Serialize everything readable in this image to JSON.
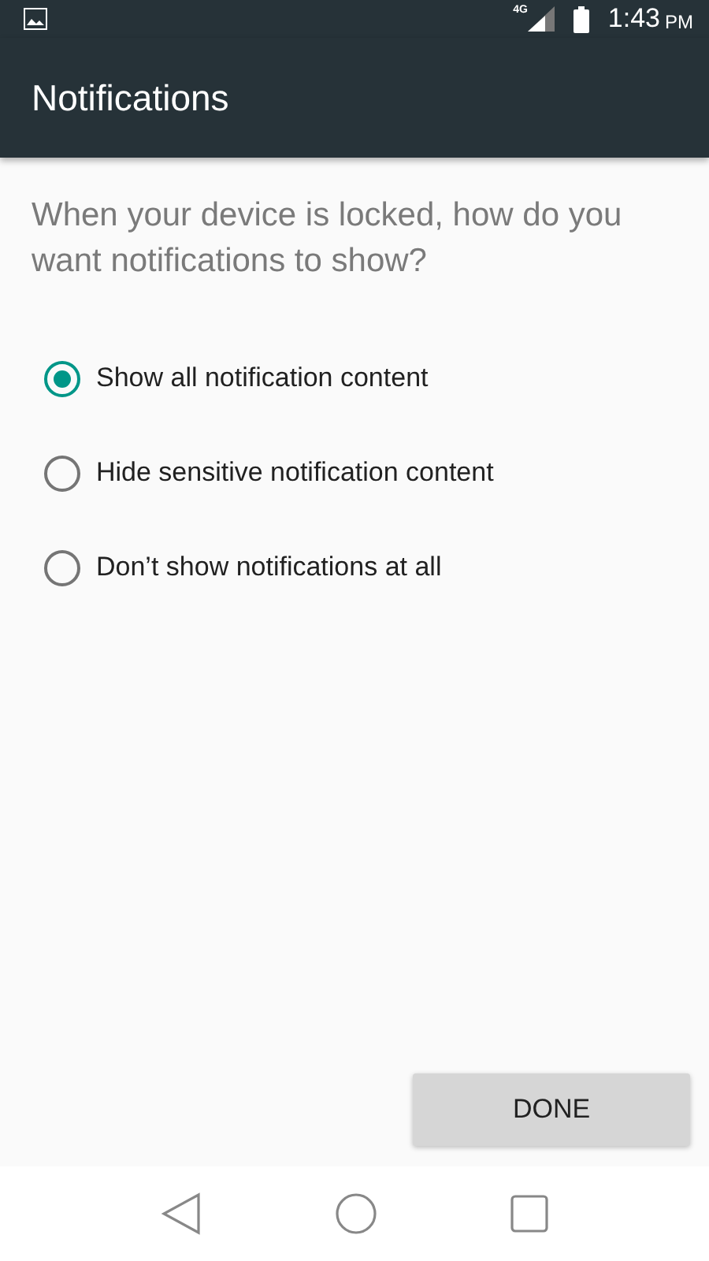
{
  "status_bar": {
    "network_type": "4G",
    "time": "1:43",
    "time_suffix": "PM"
  },
  "toolbar": {
    "title": "Notifications"
  },
  "question": "When your device is locked, how do you want notifications to show?",
  "options": [
    {
      "label": "Show all notification content",
      "selected": true
    },
    {
      "label": "Hide sensitive notification content",
      "selected": false
    },
    {
      "label": "Don’t show notifications at all",
      "selected": false
    }
  ],
  "done_button": "DONE"
}
